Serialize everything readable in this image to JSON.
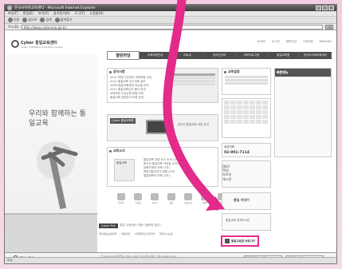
{
  "browser": {
    "title": "한국사이버교육센터 - Microsoft Internet Explorer",
    "menu": [
      "파일(F)",
      "편집(E)",
      "보기(V)",
      "즐겨찾기(A)",
      "도구(T)",
      "도움말(H)"
    ],
    "toolbar": [
      "뒤로",
      "앞으로",
      "검색",
      "즐겨찾기"
    ],
    "address_label": "주소(D)",
    "address": "http://www.cyberedu.go.kr/",
    "go_label": "이동",
    "status": "완료"
  },
  "site": {
    "logo": "Cyber 통일교육센터",
    "logo_sub": "Cyber Unification Education Center",
    "top_links": [
      "HOME",
      "로그인",
      "회원가입",
      "사이트맵",
      "ENGLISH"
    ],
    "nav": [
      "열린마당",
      "교육과정안내",
      "자료실",
      "온라인강좌",
      "교육프로그램",
      "통일교육원",
      "한국사이버교육센터"
    ],
    "nav_active_index": 0,
    "slogan": "우리와 함께하는 통일교육",
    "notice_title": "공지사항",
    "notices": [
      "2012 하반기 온라인 교육과정 안내",
      "2012 통일교육 우수사례 공모",
      "사이버 통일교육센터 리뉴얼 안내",
      "2012 통일교육주간 행사 안내",
      "교육과정 수강신청 방법 안내",
      "통일교육 전문강사 모집 안내"
    ],
    "banner_title": "Cyber 통일교육원",
    "banner_text": "온라인 통일교육 과정 안내",
    "news_title": "교육소식",
    "news": [
      "통일교육 관련 도서 소개 (1차)",
      "청소년 통일교육 자료집 (2차)",
      "남북관계의 이해 (1차)",
      "북한이탈주민의 생활 (1차)",
      "통일정책의 이해 (1차)"
    ],
    "notice_badge": "통일교육",
    "calendar_title": "교육일정",
    "phone_label": "상담전화",
    "phone": "02-901-7114",
    "quick_title": "빠른메뉴",
    "quick_items": [
      "Q&A",
      "FAQ",
      "자료실",
      "게시판"
    ],
    "icon_row": [
      "온라인",
      "자료실",
      "게시판",
      "설문",
      "통일교육",
      "이벤트",
      "교육문의"
    ],
    "search_chip": "Cyber Poll",
    "search_text": "통일 교육센터 이용시 불편한 점은?",
    "bottom_links": [
      "개인정보보호정책",
      "이용약관",
      "이메일무단수집거부",
      "찾아오시는길"
    ],
    "side_banner_1": "통일 이야기",
    "side_banner_2": "통일교육 전자도서관",
    "highlight_label": "통일교육원 바로가기",
    "footer_logo": "통일교육원",
    "footer_address": "(우)142-729 서울특별시 강북구 4.19로 123 통일교육원 / TEL 02-901-7114",
    "footer_copy": "Copyright (C) 2005 All Rights reserved. Cyber Unification Education Center",
    "footer_select_1": "통일교육관련 사이트",
    "footer_select_2": "유관기관 사이트"
  },
  "colors": {
    "accent": "#e22b8b",
    "nav_bg": "#4d4d4d"
  }
}
